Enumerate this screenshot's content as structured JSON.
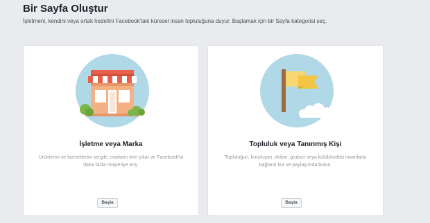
{
  "page": {
    "title": "Bir Sayfa Oluştur",
    "subtitle": "İşletmeni, kendini veya ortak hedefini Facebook'taki küresel insan topluluğuna duyur. Başlamak için bir Sayfa kategorisi seç."
  },
  "cards": [
    {
      "icon": "storefront-icon",
      "title": "İşletme veya Marka",
      "description": "Ürünlerini ve hizmetlerini sergile, markanı öne çıkar ve Facebook'ta daha fazla müşteriye eriş.",
      "button_label": "Başla"
    },
    {
      "icon": "flag-icon",
      "title": "Topluluk veya Tanınmış Kişi",
      "description": "Topluluğun, kuruluşun, ekibin, grubun veya kulübündeki insanlarla bağlantı kur ve paylaşımda bulun.",
      "button_label": "Başla"
    }
  ],
  "colors": {
    "background": "#e9ebee",
    "circle": "#add8e6",
    "awning_stripe": "#e9604a",
    "flag": "#f7cf5b",
    "pole": "#9c6b40"
  }
}
